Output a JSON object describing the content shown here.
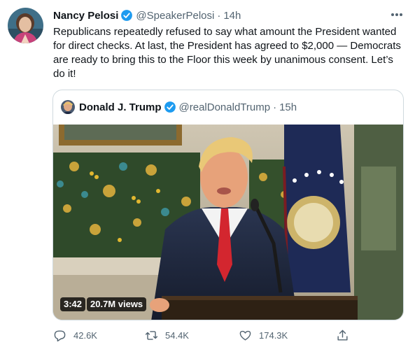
{
  "author": {
    "name": "Nancy Pelosi",
    "handle": "@SpeakerPelosi",
    "time": "14h"
  },
  "tweet_text": "Republicans repeatedly refused to say what amount the President wanted for direct checks. At last, the President has agreed to $2,000 — Democrats are ready to bring this to the Floor this week by unanimous consent. Let’s do it!",
  "quoted": {
    "name": "Donald J. Trump",
    "handle": "@realDonaldTrump",
    "time": "15h",
    "video_duration": "3:42",
    "video_views": "20.7M views"
  },
  "actions": {
    "replies": "42.6K",
    "retweets": "54.4K",
    "likes": "174.3K"
  },
  "colors": {
    "verified": "#1d9bf0",
    "secondary_text": "#536471",
    "border": "#cfd9de"
  },
  "icons": [
    "verified-badge-icon",
    "more-icon",
    "reply-icon",
    "retweet-icon",
    "like-icon",
    "share-icon"
  ]
}
